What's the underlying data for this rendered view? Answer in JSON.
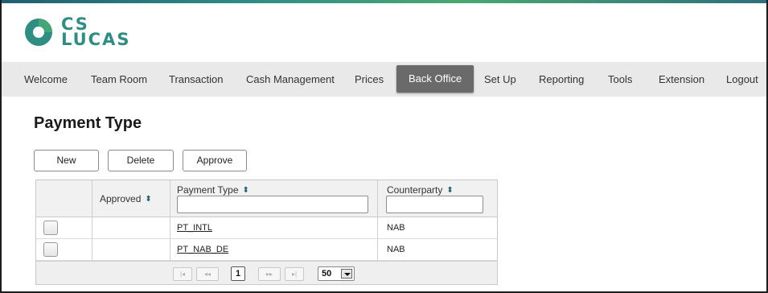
{
  "brand": {
    "line1": "CS",
    "line2": "LUCAS",
    "logo_icon": "cs-lucas-logo-icon",
    "brand_color": "#2e8e84",
    "accent_color": "#1f5f74"
  },
  "nav": {
    "items": [
      {
        "label": "Welcome"
      },
      {
        "label": "Team Room"
      },
      {
        "label": "Transaction"
      },
      {
        "label": "Cash Management"
      },
      {
        "label": "Prices"
      },
      {
        "label": "Back Office",
        "active": true
      },
      {
        "label": "Set Up"
      },
      {
        "label": "Reporting"
      },
      {
        "label": "Tools"
      },
      {
        "label": "Extension"
      },
      {
        "label": "Logout"
      }
    ]
  },
  "page": {
    "title": "Payment Type"
  },
  "toolbar": {
    "new_label": "New",
    "delete_label": "Delete",
    "approve_label": "Approve"
  },
  "grid": {
    "columns": [
      {
        "label": "",
        "key": "select"
      },
      {
        "label": "Approved",
        "key": "approved",
        "sort_icon": "sort-icon"
      },
      {
        "label": "Payment Type",
        "key": "payment_type",
        "sort_icon": "sort-icon",
        "filter_value": "",
        "filter_placeholder": ""
      },
      {
        "label": "Counterparty",
        "key": "counterparty",
        "sort_icon": "sort-icon",
        "filter_value": "",
        "filter_placeholder": ""
      }
    ],
    "rows": [
      {
        "approved": "",
        "payment_type": "PT_INTL",
        "counterparty": "NAB"
      },
      {
        "approved": "",
        "payment_type": "PT_NAB_DE",
        "counterparty": "NAB"
      }
    ]
  },
  "pager": {
    "first_icon": "first-page-icon",
    "prev_icon": "prev-page-icon",
    "current_page": "1",
    "next_icon": "next-page-icon",
    "last_icon": "last-page-icon",
    "page_size": "50"
  }
}
